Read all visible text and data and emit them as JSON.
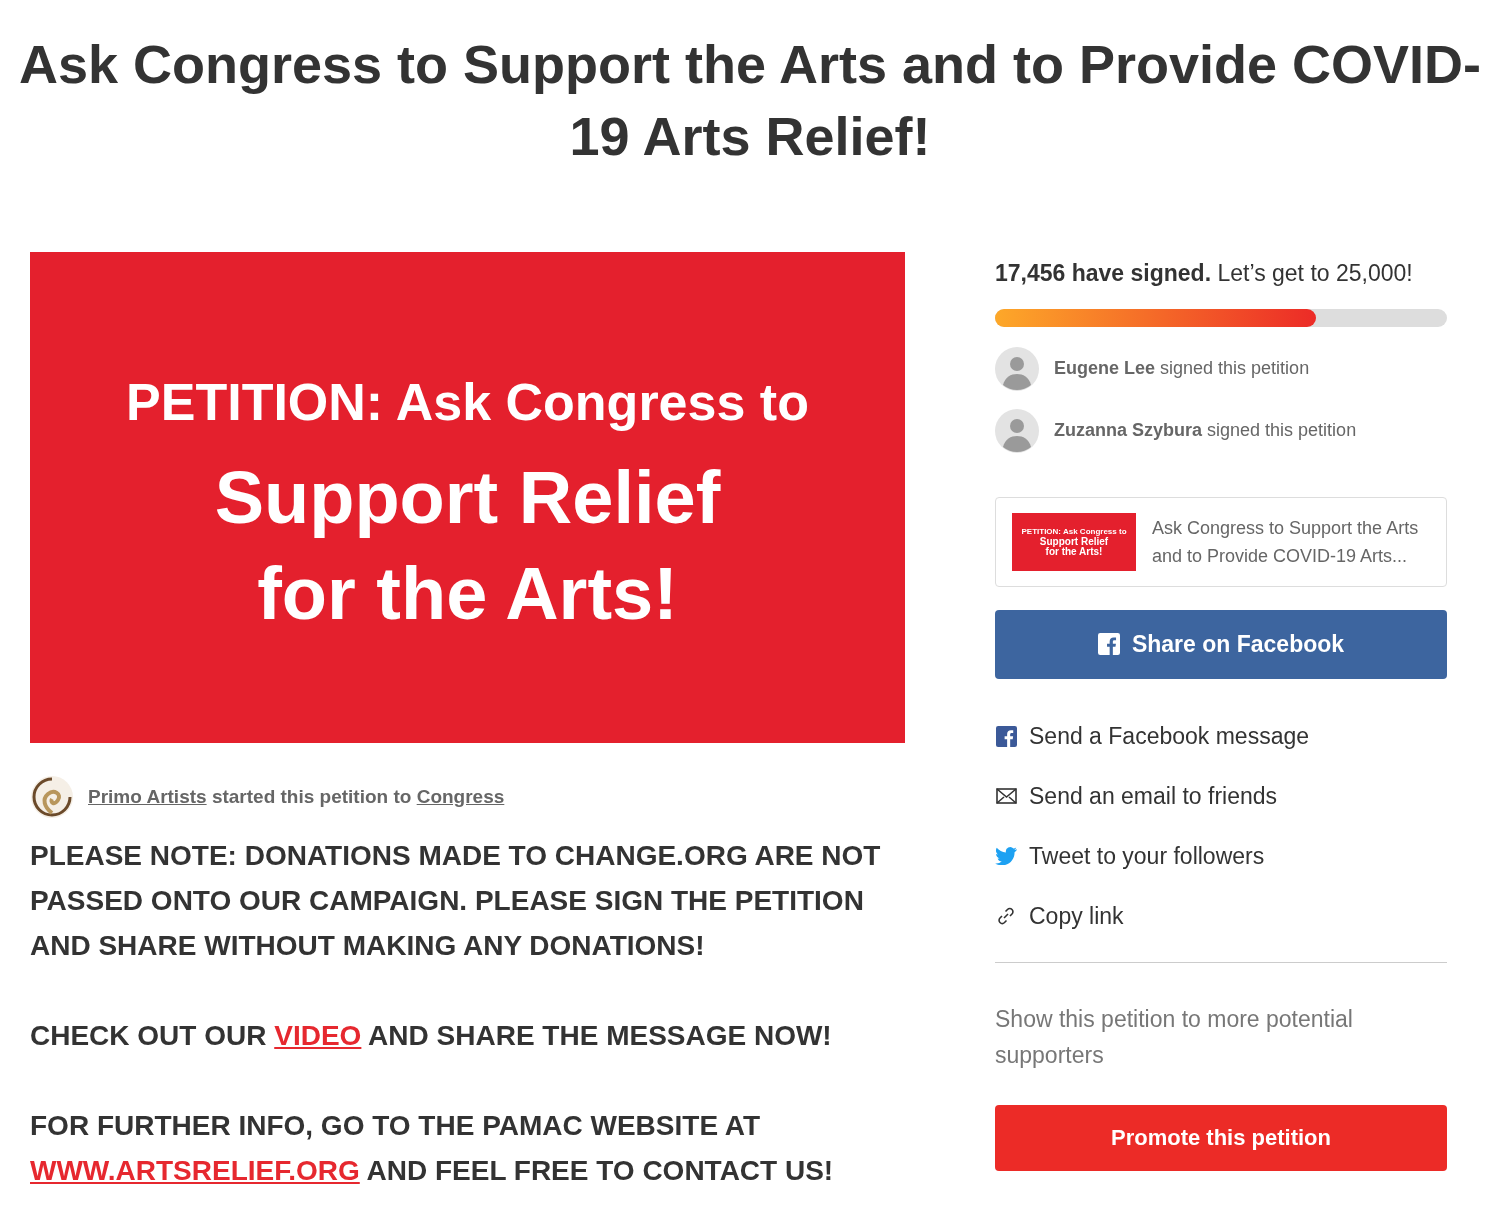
{
  "title": "Ask Congress to Support the Arts and to Provide COVID-19 Arts Relief!",
  "banner": {
    "lines": [
      "PETITION: Ask Congress to",
      "Support Relief",
      "for the Arts!"
    ]
  },
  "starter": {
    "name": "Primo Artists",
    "middle": "started this petition to",
    "target": "Congress"
  },
  "body": [
    [
      {
        "text": "PLEASE NOTE: DONATIONS MADE TO CHANGE.ORG ARE NOT PASSED ONTO OUR CAMPAIGN. PLEASE SIGN THE PETITION AND SHARE WITHOUT MAKING ANY DONATIONS!",
        "link": false
      }
    ],
    [
      {
        "text": "CHECK OUT OUR ",
        "link": false
      },
      {
        "text": "VIDEO",
        "link": true
      },
      {
        "text": " AND SHARE THE MESSAGE NOW!",
        "link": false
      }
    ],
    [
      {
        "text": "FOR FURTHER INFO, GO TO THE PAMAC WEBSITE AT ",
        "link": false
      },
      {
        "text": "WWW.ARTSRELIEF.ORG",
        "link": true
      },
      {
        "text": " AND FEEL FREE TO CONTACT US!",
        "link": false
      }
    ]
  ],
  "progress": {
    "count": "17,456 have signed.",
    "goal": "Let’s get to 25,000!",
    "level": 0.71
  },
  "signers": [
    {
      "name": "Eugene Lee",
      "action": "signed this petition"
    },
    {
      "name": "Zuzanna Szybura",
      "action": "signed this petition"
    }
  ],
  "preview": {
    "thumb_lines": [
      "PETITION: Ask Congress to",
      "Support Relief",
      "for the Arts!"
    ],
    "title": "Ask Congress to Support the Arts and to Provide COVID-19 Arts..."
  },
  "share_button": "Share on Facebook",
  "share_options": [
    {
      "kind": "facebook",
      "label": "Send a Facebook message"
    },
    {
      "kind": "email",
      "label": "Send an email to friends"
    },
    {
      "kind": "twitter",
      "label": "Tweet to your followers"
    },
    {
      "kind": "link",
      "label": "Copy link"
    }
  ],
  "promote": {
    "text": "Show this petition to more potential supporters",
    "button": "Promote this petition"
  }
}
